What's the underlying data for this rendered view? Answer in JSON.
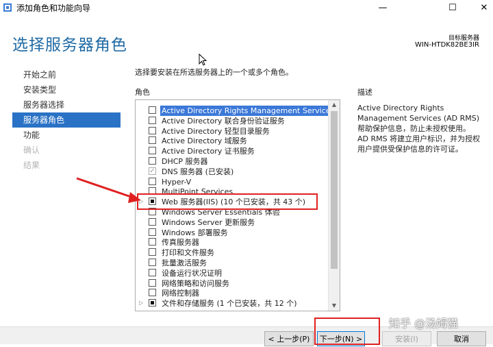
{
  "window": {
    "title": "添加角色和功能向导",
    "min": "—",
    "max": "☐",
    "close": "✕"
  },
  "header": {
    "page_title": "选择服务器角色",
    "target_label": "目标服务器",
    "target_value": "WIN-HTDK82BE3IR"
  },
  "nav": {
    "items": [
      {
        "label": "开始之前",
        "state": "normal"
      },
      {
        "label": "安装类型",
        "state": "normal"
      },
      {
        "label": "服务器选择",
        "state": "normal"
      },
      {
        "label": "服务器角色",
        "state": "active"
      },
      {
        "label": "功能",
        "state": "normal"
      },
      {
        "label": "确认",
        "state": "disabled"
      },
      {
        "label": "结果",
        "state": "disabled"
      }
    ]
  },
  "main": {
    "instruction": "选择要安装在所选服务器上的一个或多个角色。",
    "roles_header": "角色",
    "description_header": "描述",
    "description_text": "Active Directory Rights\nManagement Services (AD RMS)\n帮助保护信息，防止未授权使用。\nAD RMS 将建立用户标识，并为授权\n用户提供受保护信息的许可证。",
    "roles": [
      {
        "label": "Active Directory Rights Management Services",
        "state": "unchecked",
        "selected": true,
        "expandable": false
      },
      {
        "label": "Active Directory 联合身份验证服务",
        "state": "unchecked",
        "selected": false,
        "expandable": false
      },
      {
        "label": "Active Directory 轻型目录服务",
        "state": "unchecked",
        "selected": false,
        "expandable": false
      },
      {
        "label": "Active Directory 域服务",
        "state": "unchecked",
        "selected": false,
        "expandable": false
      },
      {
        "label": "Active Directory 证书服务",
        "state": "unchecked",
        "selected": false,
        "expandable": false
      },
      {
        "label": "DHCP 服务器",
        "state": "unchecked",
        "selected": false,
        "expandable": false
      },
      {
        "label": "DNS 服务器 (已安装)",
        "state": "checked",
        "selected": false,
        "expandable": false
      },
      {
        "label": "Hyper-V",
        "state": "unchecked",
        "selected": false,
        "expandable": false
      },
      {
        "label": "MultiPoint Services",
        "state": "unchecked",
        "selected": false,
        "expandable": false
      },
      {
        "label": "Web 服务器(IIS) (10 个已安装，共 43 个)",
        "state": "partial",
        "selected": false,
        "expandable": true
      },
      {
        "label": "Windows Server Essentials 体验",
        "state": "unchecked",
        "selected": false,
        "expandable": false
      },
      {
        "label": "Windows Server 更新服务",
        "state": "unchecked",
        "selected": false,
        "expandable": false
      },
      {
        "label": "Windows 部署服务",
        "state": "unchecked",
        "selected": false,
        "expandable": false
      },
      {
        "label": "传真服务器",
        "state": "unchecked",
        "selected": false,
        "expandable": false
      },
      {
        "label": "打印和文件服务",
        "state": "unchecked",
        "selected": false,
        "expandable": false
      },
      {
        "label": "批量激活服务",
        "state": "unchecked",
        "selected": false,
        "expandable": false
      },
      {
        "label": "设备运行状况证明",
        "state": "unchecked",
        "selected": false,
        "expandable": false
      },
      {
        "label": "网络策略和访问服务",
        "state": "unchecked",
        "selected": false,
        "expandable": false
      },
      {
        "label": "网络控制器",
        "state": "unchecked",
        "selected": false,
        "expandable": false
      },
      {
        "label": "文件和存储服务 (1 个已安装，共 12 个)",
        "state": "partial",
        "selected": false,
        "expandable": true
      }
    ]
  },
  "buttons": {
    "prev": "< 上一步(P)",
    "next": "下一步(N) >",
    "install": "安装(I)",
    "cancel": "取消"
  },
  "watermark": "知乎 @汤姆猫",
  "colors": {
    "title_blue": "#1f6aa5",
    "nav_active": "#2a72c5",
    "highlight_red": "#e02020"
  }
}
